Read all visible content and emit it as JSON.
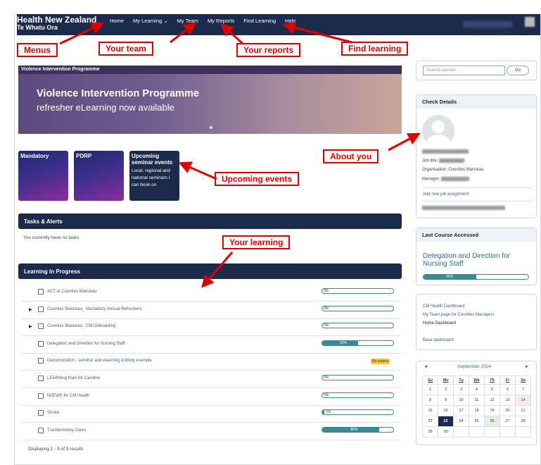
{
  "header": {
    "brand_line1": "Health New Zealand",
    "brand_line2": "Te Whatu Ora",
    "nav": [
      "Home",
      "My Learning ⌄",
      "My Team",
      "My Reports",
      "Find Learning",
      "Help"
    ]
  },
  "callouts": {
    "menus": "Menus",
    "team": "Your team",
    "reports": "Your reports",
    "find": "Find learning",
    "about": "About you",
    "events": "Upcoming events",
    "learning": "Your learning"
  },
  "hero": {
    "caption": "Violence Intervention Programme",
    "title": "Violence Intervention Programme",
    "subtitle": "refresher eLearning now available"
  },
  "tiles": {
    "t1": "Mandatory",
    "t2": "PDRP",
    "t3": "Upcoming seminar events",
    "t3_desc": "Local, regional and national seminars I can book on"
  },
  "tasks": {
    "title": "Tasks & Alerts",
    "empty": "You currently have no tasks"
  },
  "learning": {
    "title": "Learning In Progress",
    "rows": [
      {
        "label": "ACT at Counties Manukau",
        "progress": 0,
        "pct": "0%"
      },
      {
        "label": "Counties Manukau_ Mandatory Annual Refreshers",
        "progress": 0,
        "pct": "0%"
      },
      {
        "label": "Counties Manukau_ CM Onboarding",
        "progress": 0,
        "pct": "0%"
      },
      {
        "label": "Delegation and Direction for Nursing Staff",
        "progress": 50,
        "pct": "50%"
      },
      {
        "label": "Demonstration - seminar and elearning knitting example",
        "badge": "No criteria"
      },
      {
        "label": "LEARNing trials for Caroline",
        "progress": 0,
        "pct": "0%"
      },
      {
        "label": "NZEWS for CM Health",
        "progress": 0,
        "pct": "0%"
      },
      {
        "label": "Stroke",
        "progress": 3,
        "pct": "3%"
      },
      {
        "label": "Tracheostomy Cares",
        "progress": 80,
        "pct": "80%"
      }
    ],
    "footer": "Displaying 1 - 9 of 9 results"
  },
  "sidebar": {
    "search_placeholder": "Search courses",
    "go": "Go",
    "check_details": "Check Details",
    "job_title": "Job title:",
    "organisation": "Organisation: Counties Manukau",
    "manager": "Manager:",
    "add_job": "Add new job assignment",
    "last_course_title": "Last Course Accessed",
    "last_course": "Delegation and Direction for Nursing Staff",
    "last_course_progress": 50,
    "last_course_pct": "50%",
    "links": [
      "CM Health Dashboard",
      "My Team page for Counties Managers",
      "Home Dashboard",
      "Base dashboard"
    ]
  },
  "calendar": {
    "month": "September 2024",
    "prev": "◄",
    "next": "►",
    "days": [
      "Su",
      "Mo",
      "Tu",
      "We",
      "Th",
      "Fr",
      "Sa"
    ],
    "weeks": [
      [
        "1",
        "2",
        "3",
        "4",
        "5",
        "6",
        "7"
      ],
      [
        "8",
        "9",
        "10",
        "11",
        "12",
        "13",
        "14"
      ],
      [
        "15",
        "16",
        "17",
        "18",
        "19",
        "20",
        "21"
      ],
      [
        "22",
        "23",
        "24",
        "25",
        "26",
        "27",
        "28"
      ],
      [
        "29",
        "30",
        "",
        "",
        "",
        "",
        ""
      ]
    ],
    "today": "23"
  },
  "colors": {
    "nav": "#1c2a4b",
    "accent": "#3a8a95",
    "callout": "#e10000"
  }
}
